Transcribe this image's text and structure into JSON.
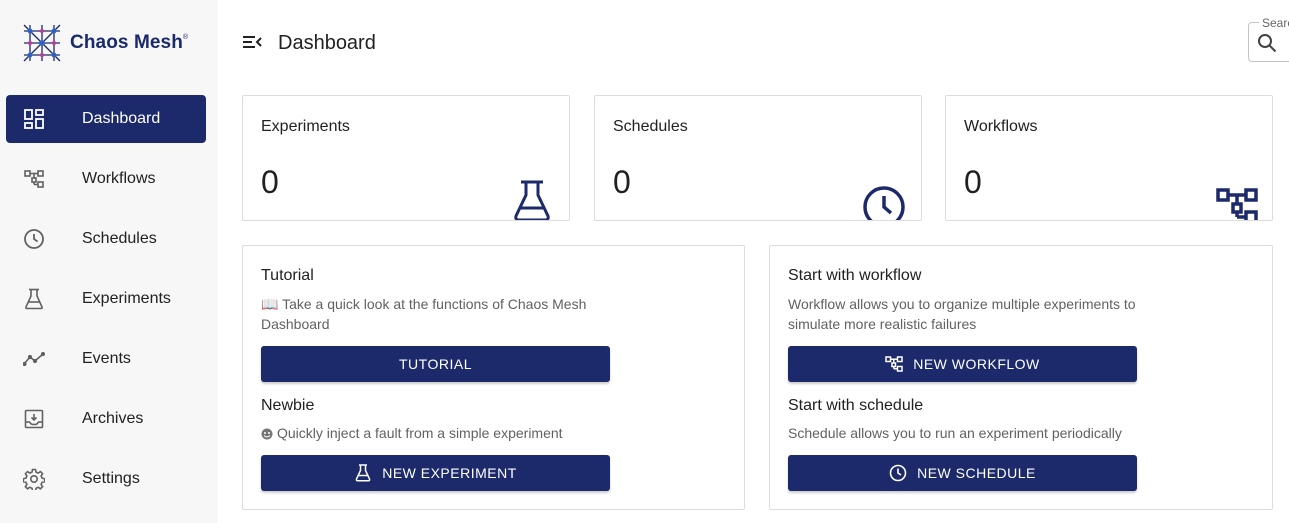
{
  "app": {
    "brand_name": "Chaos Mesh",
    "brand_mark": "®"
  },
  "colors": {
    "primary": "#1c2a6b",
    "sidebar_bg": "#f7f7f8",
    "border": "#dcdcdc"
  },
  "sidebar": {
    "items": [
      {
        "label": "Dashboard",
        "icon": "dashboard-icon",
        "active": true
      },
      {
        "label": "Workflows",
        "icon": "workflow-icon",
        "active": false
      },
      {
        "label": "Schedules",
        "icon": "clock-icon",
        "active": false
      },
      {
        "label": "Experiments",
        "icon": "flask-icon",
        "active": false
      },
      {
        "label": "Events",
        "icon": "timeline-icon",
        "active": false
      },
      {
        "label": "Archives",
        "icon": "archive-icon",
        "active": false
      },
      {
        "label": "Settings",
        "icon": "gear-icon",
        "active": false
      }
    ]
  },
  "header": {
    "title": "Dashboard",
    "search_label": "Search"
  },
  "stats": [
    {
      "title": "Experiments",
      "value": "0",
      "icon": "flask-icon"
    },
    {
      "title": "Schedules",
      "value": "0",
      "icon": "clock-icon"
    },
    {
      "title": "Workflows",
      "value": "0",
      "icon": "workflow-icon"
    }
  ],
  "panels": {
    "left": {
      "tutorial_heading": "Tutorial",
      "tutorial_desc": "📖 Take a quick look at the functions of Chaos Mesh Dashboard",
      "tutorial_button": "TUTORIAL",
      "newbie_heading": "Newbie",
      "newbie_desc": "Quickly inject a fault from a simple experiment",
      "newbie_desc_icon": "emoji-icon",
      "newbie_button": "NEW EXPERIMENT"
    },
    "right": {
      "workflow_heading": "Start with workflow",
      "workflow_desc": "Workflow allows you to organize multiple experiments to simulate more realistic failures",
      "workflow_button": "NEW WORKFLOW",
      "schedule_heading": "Start with schedule",
      "schedule_desc": "Schedule allows you to run an experiment periodically",
      "schedule_button": "NEW SCHEDULE"
    }
  }
}
